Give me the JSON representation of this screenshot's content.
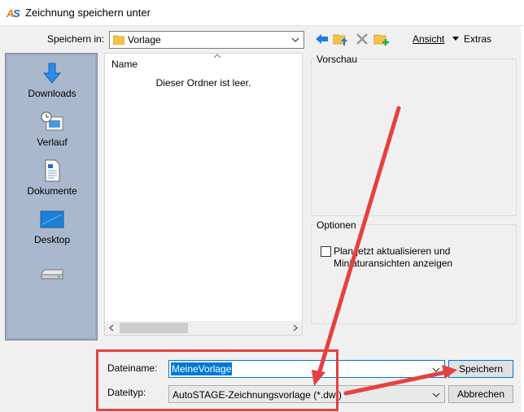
{
  "window": {
    "title": "Zeichnung speichern unter"
  },
  "toolbar": {
    "save_in_label": "Speichern in:",
    "save_in_value": "Vorlage",
    "view_label": "Ansicht",
    "extras_label": "Extras"
  },
  "places": [
    {
      "label": "Downloads",
      "icon": "downloads-icon"
    },
    {
      "label": "Verlauf",
      "icon": "history-icon"
    },
    {
      "label": "Dokumente",
      "icon": "documents-icon"
    },
    {
      "label": "Desktop",
      "icon": "desktop-icon"
    },
    {
      "label": "",
      "icon": "drive-icon"
    }
  ],
  "file_list": {
    "column_name": "Name",
    "empty_message": "Dieser Ordner ist leer."
  },
  "preview": {
    "label": "Vorschau"
  },
  "options": {
    "label": "Optionen",
    "checkbox_label": "Plan jetzt aktualisieren und Miniaturansichten anzeigen",
    "checked": false
  },
  "bottom": {
    "filename_label": "Dateiname:",
    "filename_value": "MeineVorlage",
    "filetype_label": "Dateityp:",
    "filetype_value": "AutoSTAGE-Zeichnungsvorlage (*.dwt)",
    "save_button": "Speichern",
    "cancel_button": "Abbrechen"
  },
  "colors": {
    "accent": "#0078d7",
    "annotation": "#e64040",
    "places_bg": "#a9b8cc"
  }
}
